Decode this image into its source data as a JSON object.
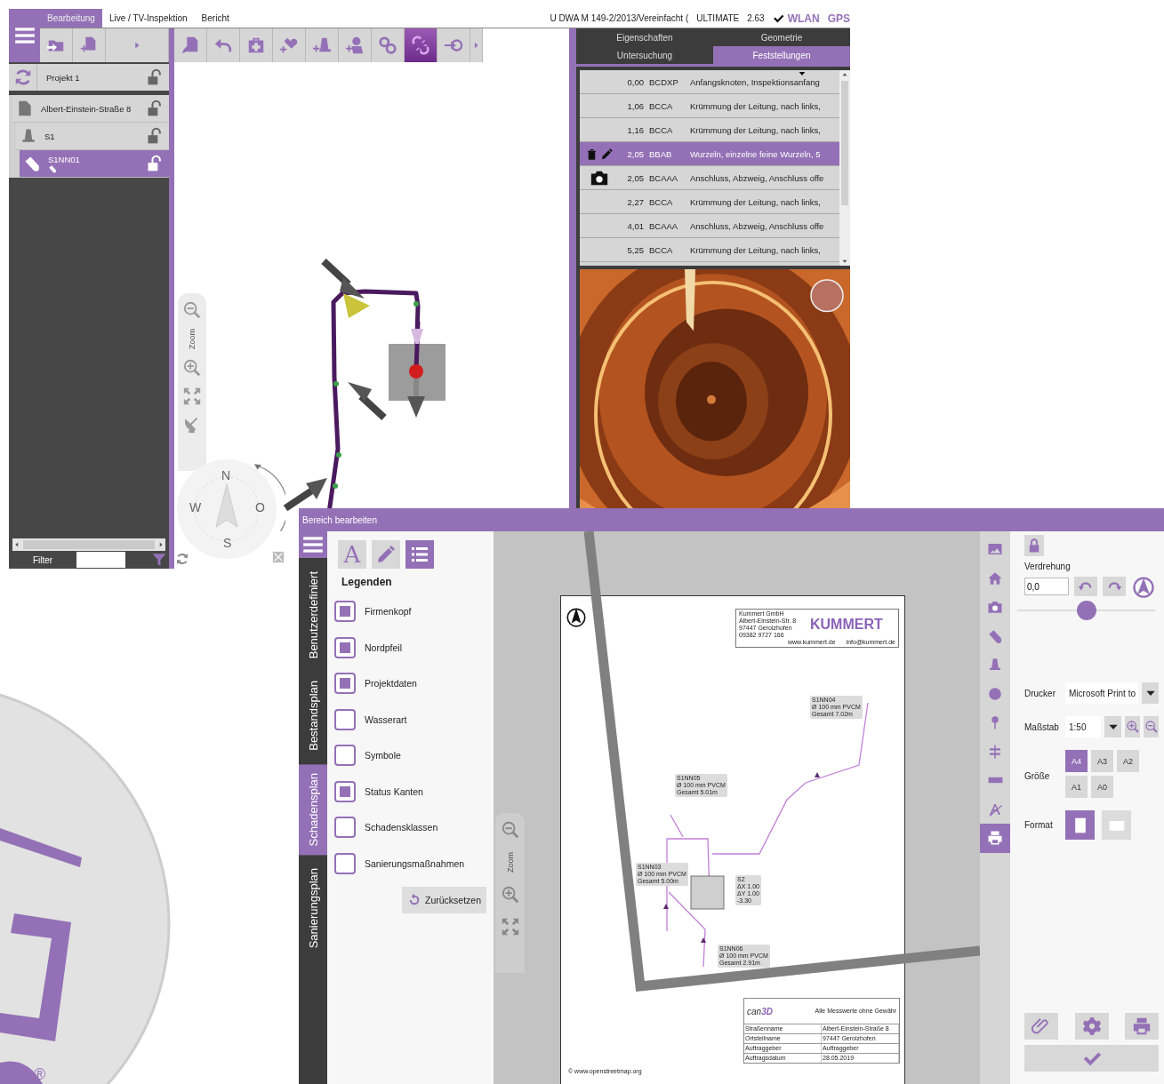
{
  "backdrop": {
    "mark": "®"
  },
  "main_window": {
    "tabs": [
      {
        "label": "Bearbeitung",
        "selected": true
      },
      {
        "label": "Live / TV-Inspektion",
        "selected": false
      },
      {
        "label": "Bericht",
        "selected": false
      }
    ],
    "status": {
      "norm": "U  DWA M 149-2/2013/Vereinfacht (",
      "edition": "ULTIMATE",
      "version": "2.63",
      "wlan": "WLAN",
      "gps": "GPS"
    },
    "tools": [
      {
        "selected": false
      },
      {
        "selected": false
      },
      {
        "selected": false
      },
      {
        "selected": false
      },
      {
        "selected": false
      },
      {
        "selected": false
      },
      {
        "selected": false
      },
      {
        "selected": true
      },
      {
        "selected": false
      }
    ],
    "project": "Projekt 1",
    "tree": [
      {
        "label": "Albert-Einstein-Straße 8",
        "kind": "street",
        "selected": false,
        "children": [
          {
            "label": "S1",
            "kind": "manhole",
            "selected": false,
            "children": [
              {
                "label": "S1NN01",
                "kind": "pipe",
                "selected": true
              }
            ]
          }
        ]
      }
    ],
    "filter": "Filter",
    "map": {
      "zoom_label": "Zoom",
      "compass": [
        "N",
        "W",
        "O",
        "S"
      ]
    },
    "panel_tabs": [
      {
        "label": "Eigenschaften",
        "selected": false
      },
      {
        "label": "Geometrie",
        "selected": false
      },
      {
        "label": "Untersuchung",
        "selected": false
      },
      {
        "label": "Feststellungen",
        "selected": true
      }
    ],
    "findings": [
      {
        "distance": "0,00",
        "code": "BCDXP",
        "text": "Anfangsknoten, Inspektionsanfang",
        "selected": false,
        "has_photo": false
      },
      {
        "distance": "1,06",
        "code": "BCCA",
        "text": "Krümmung der Leitung, nach links,",
        "selected": false,
        "has_photo": false
      },
      {
        "distance": "1,16",
        "code": "BCCA",
        "text": "Krümmung der Leitung, nach links,",
        "selected": false,
        "has_photo": false
      },
      {
        "distance": "2,05",
        "code": "BBAB",
        "text": "Wurzeln, einzelne feine Wurzeln, 5",
        "selected": true,
        "has_photo": false
      },
      {
        "distance": "2,05",
        "code": "BCAAA",
        "text": "Anschluss, Abzweig, Anschluss offe",
        "selected": false,
        "has_photo": true
      },
      {
        "distance": "2,27",
        "code": "BCCA",
        "text": "Krümmung der Leitung, nach links,",
        "selected": false,
        "has_photo": false
      },
      {
        "distance": "4,01",
        "code": "BCAAA",
        "text": "Anschluss, Abzweig, Anschluss offe",
        "selected": false,
        "has_photo": false
      },
      {
        "distance": "5,25",
        "code": "BCCA",
        "text": "Krümmung der Leitung, nach links,",
        "selected": false,
        "has_photo": false
      }
    ]
  },
  "edit_window": {
    "title": "Bereich bearbeiten",
    "side_tabs": [
      {
        "label": "Benutzerdefiniert",
        "selected": false
      },
      {
        "label": "Bestandsplan",
        "selected": false
      },
      {
        "label": "Schadensplan",
        "selected": true
      },
      {
        "label": "Sanierungsplan",
        "selected": false
      }
    ],
    "modes": [
      {
        "label": "A",
        "selected": false
      },
      {
        "selected": false
      },
      {
        "selected": true
      }
    ],
    "legend_title": "Legenden",
    "legend": [
      {
        "label": "Firmenkopf",
        "checked": true
      },
      {
        "label": "Nordpfeil",
        "checked": true
      },
      {
        "label": "Projektdaten",
        "checked": true
      },
      {
        "label": "Wasserart",
        "checked": false
      },
      {
        "label": "Symbole",
        "checked": false
      },
      {
        "label": "Status Kanten",
        "checked": true
      },
      {
        "label": "Schadensklassen",
        "checked": false
      },
      {
        "label": "Sanierungsmaßnahmen",
        "checked": false
      }
    ],
    "reset": "Zurücksetzen",
    "zoom_label": "Zoom",
    "sheet": {
      "company_lines": [
        "Kummert GmbH",
        "Albert-Einstein-Str. 8",
        "97447 Gerolzhofen",
        "09382 9727 166"
      ],
      "brand": "KUMMERT",
      "web": "www.kummert.de",
      "mail": "info@kummert.de",
      "labels": [
        {
          "lines": [
            "S1NN04",
            "Ø 100 mm PVCM",
            "Gesamt 7.02m"
          ]
        },
        {
          "lines": [
            "S1NN05",
            "Ø 100 mm PVCM",
            "Gesamt 5.01m"
          ]
        },
        {
          "lines": [
            "S1NN03",
            "Ø 100 mm PVCM",
            "Gesamt 5.00m"
          ]
        },
        {
          "lines": [
            "S2",
            "ΔX 1.00",
            "ΔY 1.00",
            "-3.30"
          ]
        },
        {
          "lines": [
            "S1NN06",
            "Ø 100 mm PVCM",
            "Gesamt 2.91m"
          ]
        }
      ],
      "footer": {
        "logo": "can",
        "logo_accent": "3D",
        "note": "Alle Messwerte ohne Gewähr",
        "rows": [
          [
            "Straßenname",
            "Albert-Einstein-Straße 8"
          ],
          [
            "Ortsteilname",
            "97447 Gerolzhofen"
          ],
          [
            "Auftraggeber",
            "Auftraggeber"
          ],
          [
            "Auftragsdatum",
            "28.05.2019"
          ]
        ]
      },
      "credit": "© www.openstreetmap.org"
    },
    "tool_strip": [
      {
        "selected": false
      },
      {
        "selected": false
      },
      {
        "selected": false
      },
      {
        "selected": false
      },
      {
        "selected": false
      },
      {
        "selected": false
      },
      {
        "selected": false
      },
      {
        "selected": false
      },
      {
        "selected": false
      },
      {
        "selected": false
      },
      {
        "selected": true
      }
    ],
    "print": {
      "rotation_label": "Verdrehung",
      "rotation": "0,0",
      "slider": {
        "level": 0.5
      },
      "printer_label": "Drucker",
      "printer": "Microsoft Print to",
      "scale_label": "Maßstab",
      "scale": "1:50",
      "size_label": "Größe",
      "sizes": [
        {
          "label": "A4",
          "selected": true
        },
        {
          "label": "A3",
          "selected": false
        },
        {
          "label": "A2",
          "selected": false
        },
        {
          "label": "A1",
          "selected": false
        },
        {
          "label": "A0",
          "selected": false
        }
      ],
      "format_label": "Format",
      "formats": [
        {
          "kind": "portrait",
          "selected": true
        },
        {
          "kind": "landscape",
          "selected": false
        }
      ]
    }
  }
}
